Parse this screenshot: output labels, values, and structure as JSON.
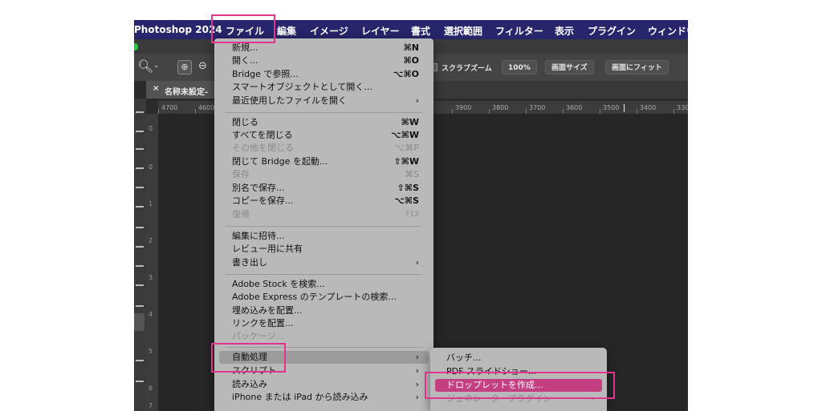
{
  "menubar": {
    "app": "Photoshop 2024",
    "items": [
      "ファイル",
      "編集",
      "イメージ",
      "レイヤー",
      "書式",
      "選択範囲",
      "フィルター",
      "表示",
      "プラグイン",
      "ウィンドウ"
    ]
  },
  "optionsbar": {
    "scrubby_zoom": "スクラブズーム",
    "zoom_level": "100%",
    "fit_screen": "画面サイズ",
    "fill_screen": "画面にフィット"
  },
  "document_tab": {
    "close": "×",
    "title": "名称未設定-"
  },
  "ruler": {
    "ticks": [
      "4700",
      "4600",
      "3900",
      "3800",
      "3700",
      "3600",
      "3500",
      "3400",
      "330"
    ]
  },
  "vruler": {
    "labels": [
      "0",
      "0",
      "1",
      "2",
      "3",
      "4",
      "5",
      "6",
      "7"
    ]
  },
  "file_menu": {
    "new": {
      "label": "新規...",
      "shortcut": "⌘N"
    },
    "open": {
      "label": "開く...",
      "shortcut": "⌘O"
    },
    "browse_bridge": {
      "label": "Bridge で参照...",
      "shortcut": "⌥⌘O"
    },
    "open_smart": {
      "label": "スマートオブジェクトとして開く..."
    },
    "recent": {
      "label": "最近使用したファイルを開く",
      "arrow": "›"
    },
    "close": {
      "label": "閉じる",
      "shortcut": "⌘W"
    },
    "close_all": {
      "label": "すべてを閉じる",
      "shortcut": "⌥⌘W"
    },
    "close_others": {
      "label": "その他を閉じる",
      "shortcut": "⌥⌘P"
    },
    "close_bridge": {
      "label": "閉じて Bridge を起動...",
      "shortcut": "⇧⌘W"
    },
    "save": {
      "label": "保存",
      "shortcut": "⌘S"
    },
    "save_as": {
      "label": "別名で保存...",
      "shortcut": "⇧⌘S"
    },
    "save_copy": {
      "label": "コピーを保存...",
      "shortcut": "⌥⌘S"
    },
    "revert": {
      "label": "復帰",
      "shortcut": "F12"
    },
    "invite": {
      "label": "編集に招待..."
    },
    "share_review": {
      "label": "レビュー用に共有"
    },
    "export": {
      "label": "書き出し",
      "arrow": "›"
    },
    "adobe_stock": {
      "label": "Adobe Stock を検索..."
    },
    "adobe_express": {
      "label": "Adobe Express のテンプレートの検索..."
    },
    "place_embedded": {
      "label": "埋め込みを配置..."
    },
    "place_linked": {
      "label": "リンクを配置..."
    },
    "package": {
      "label": "パッケージ..."
    },
    "automate": {
      "label": "自動処理",
      "arrow": "›"
    },
    "scripts": {
      "label": "スクリプト",
      "arrow": "›"
    },
    "import": {
      "label": "読み込み",
      "arrow": "›"
    },
    "import_iphone": {
      "label": "iPhone または iPad から読み込み",
      "arrow": "›"
    }
  },
  "automate_submenu": {
    "batch": "バッチ...",
    "pdf": "PDF スライドショー...",
    "droplet": "ドロップレットを作成...",
    "generator": "ジェネレータープラグイン",
    "arrow": "›"
  }
}
